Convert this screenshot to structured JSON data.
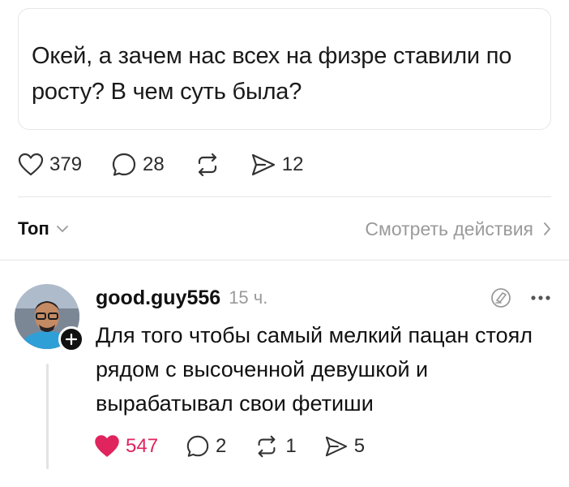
{
  "post": {
    "text": "Окей, а зачем нас всех на физре ставили по росту? В чем суть была?",
    "likes": "379",
    "comments": "28",
    "shares": "12",
    "icons": [
      "heart-icon",
      "comment-icon",
      "repost-icon",
      "share-icon"
    ]
  },
  "sort": {
    "label": "Топ",
    "view_activity_label": "Смотреть действия"
  },
  "reply": {
    "username": "good.guy556",
    "time": "15 ч.",
    "text": "Для того чтобы самый мелкий пацан стоял рядом с высоченной девушкой и вырабатывал свои фетиши",
    "likes": "547",
    "comments": "2",
    "reposts": "1",
    "shares": "5",
    "liked": true,
    "colors": {
      "like_active": "#e0245e",
      "muted": "#9a9a9a"
    }
  }
}
